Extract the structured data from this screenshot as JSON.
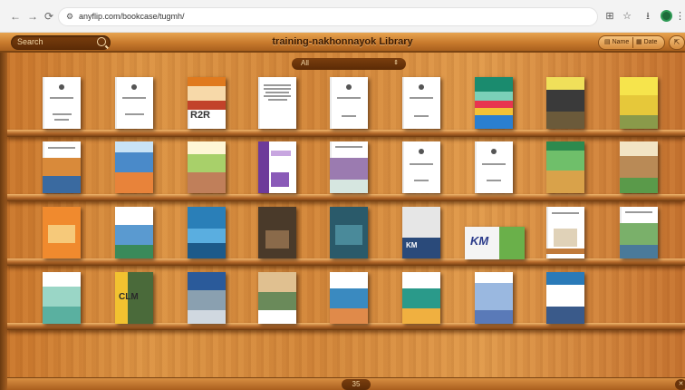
{
  "browser": {
    "url": "anyflip.com/bookcase/tugmh/",
    "back_icon": "←",
    "forward_icon": "→",
    "reload_icon": "⟳",
    "site_info_icon": "⚙",
    "translate_icon": "⊞",
    "star_icon": "☆",
    "download_icon": "⭳",
    "menu_icon": "⋮"
  },
  "header": {
    "search_placeholder": "Search",
    "title": "training-nakhonnayok Library",
    "sort_name": "Name",
    "sort_date": "Date",
    "share_icon": "⇱"
  },
  "filter": {
    "selected": "All",
    "arrow": "⇕"
  },
  "books": {
    "r1_3_label": "R2R",
    "r4_2_label": "CLM",
    "r3_8_label": "KM",
    "r3_7_label": "KM"
  },
  "footer": {
    "page_count": "35",
    "corner_icon": "✕"
  }
}
